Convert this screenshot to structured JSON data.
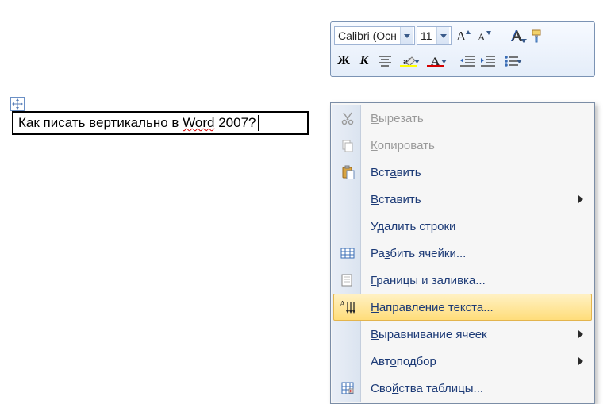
{
  "toolbar": {
    "font_name": "Calibri (Осн",
    "font_size": "11"
  },
  "cell_text_parts": {
    "pre": "Как писать вертикально в ",
    "mis": "Word",
    "post": " 2007?"
  },
  "ctx": {
    "cut": "ырезать",
    "copy": "опировать",
    "paste": "Вст",
    "paste_mid": "а",
    "paste_post": "вить",
    "paste_sub": "ставить",
    "delete_rows": "Удалить строки",
    "split": "Ра",
    "split_mid": "з",
    "split_post": "бить ячейки...",
    "borders": "раницы и заливка...",
    "textdir": "аправление текста...",
    "align": "ыравнивание ячеек",
    "autofit": "Авт",
    "autofit_mid": "о",
    "autofit_post": "подбор",
    "tableprops": "Сво",
    "tableprops_mid": "й",
    "tableprops_post": "ства таблицы..."
  }
}
